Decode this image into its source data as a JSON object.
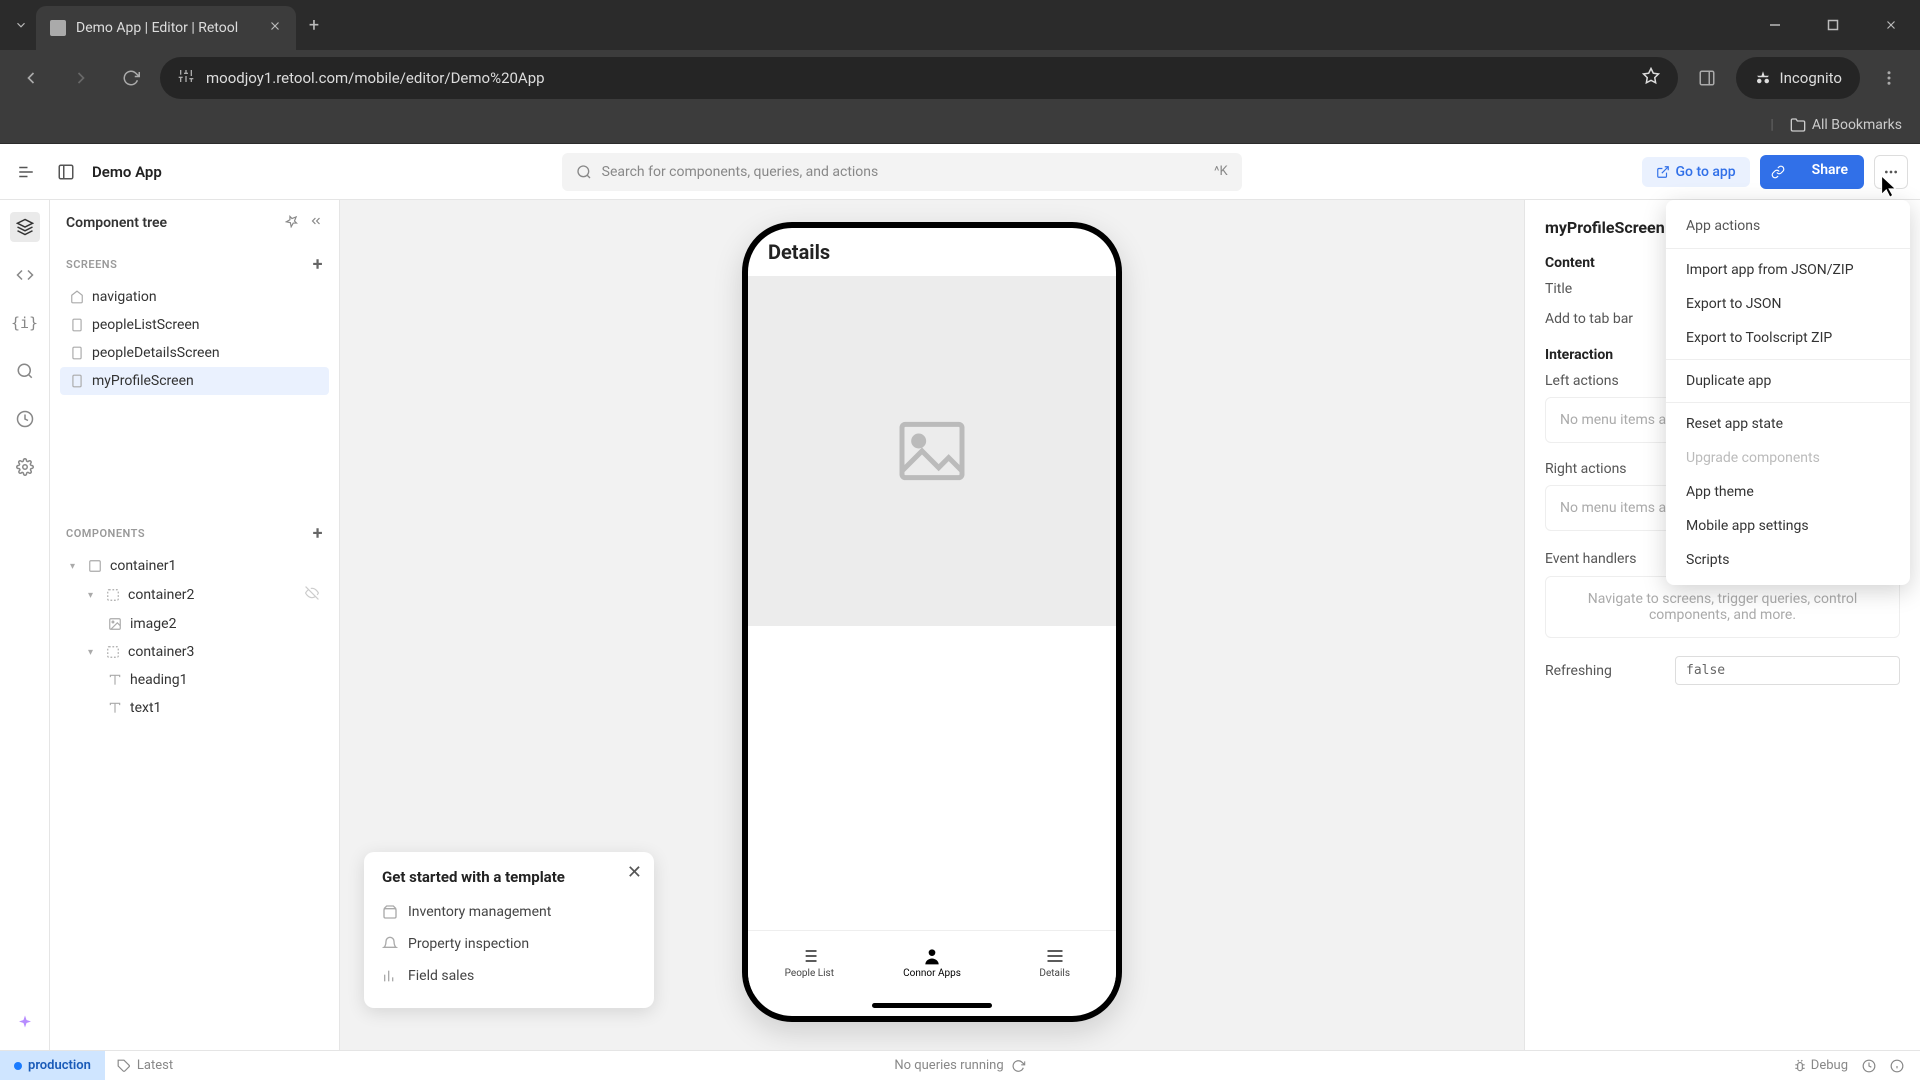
{
  "browser": {
    "tabTitle": "Demo App | Editor | Retool",
    "url": "moodjoy1.retool.com/mobile/editor/Demo%20App",
    "incognitoLabel": "Incognito",
    "allBookmarks": "All Bookmarks"
  },
  "header": {
    "appName": "Demo App",
    "searchPlaceholder": "Search for components, queries, and actions",
    "searchShortcut": "^K",
    "goToApp": "Go to app",
    "share": "Share"
  },
  "leftPanel": {
    "title": "Component tree",
    "screensHeader": "SCREENS",
    "componentsHeader": "COMPONENTS",
    "screens": [
      {
        "label": "navigation"
      },
      {
        "label": "peopleListScreen"
      },
      {
        "label": "peopleDetailsScreen"
      },
      {
        "label": "myProfileScreen"
      }
    ],
    "components": {
      "c1": "container1",
      "c2": "container2",
      "img2": "image2",
      "c3": "container3",
      "h1": "heading1",
      "t1": "text1"
    }
  },
  "templatePopup": {
    "title": "Get started with a template",
    "items": [
      "Inventory management",
      "Property inspection",
      "Field sales"
    ]
  },
  "phone": {
    "title": "Details",
    "tabs": [
      "People List",
      "Connor Apps",
      "Details"
    ]
  },
  "rightPanel": {
    "screenName": "myProfileScreen",
    "contentHeader": "Content",
    "titleLabel": "Title",
    "addToTabBar": "Add to tab bar",
    "interactionHeader": "Interaction",
    "leftActions": "Left actions",
    "rightActions": "Right actions",
    "noMenuItems": "No menu items ad",
    "eventHandlers": "Event handlers",
    "eventHint": "Navigate to screens, trigger queries, control components, and more.",
    "refreshing": "Refreshing",
    "refreshingValue": "false"
  },
  "dropdown": {
    "header": "App actions",
    "items": [
      {
        "label": "Import app from JSON/ZIP",
        "disabled": false
      },
      {
        "label": "Export to JSON",
        "disabled": false
      },
      {
        "label": "Export to Toolscript ZIP",
        "disabled": false
      }
    ],
    "items2": [
      {
        "label": "Duplicate app",
        "disabled": false
      }
    ],
    "items3": [
      {
        "label": "Reset app state",
        "disabled": false
      },
      {
        "label": "Upgrade components",
        "disabled": true
      },
      {
        "label": "App theme",
        "disabled": false
      },
      {
        "label": "Mobile app settings",
        "disabled": false
      },
      {
        "label": "Scripts",
        "disabled": false
      }
    ]
  },
  "statusBar": {
    "env": "production",
    "latest": "Latest",
    "queries": "No queries running",
    "debug": "Debug"
  }
}
